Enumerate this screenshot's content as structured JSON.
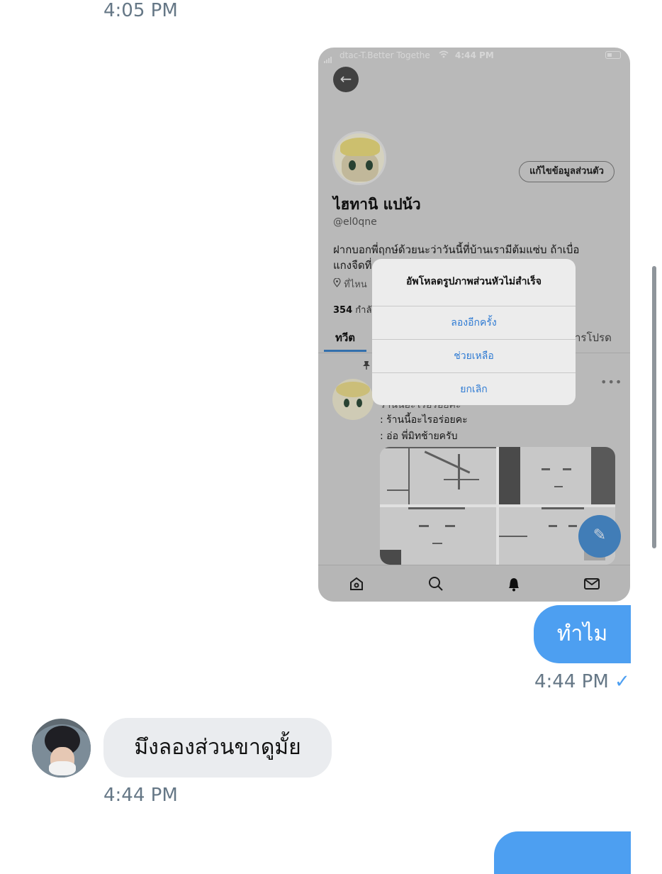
{
  "chat": {
    "timestamp_top": "4:05 PM",
    "sent_message": "ทำไม",
    "sent_time": "4:44 PM",
    "sent_check": "✓",
    "received_message": "มึงลองส่วนขาดูมั้ย",
    "received_time": "4:44 PM"
  },
  "screenshot": {
    "status_bar": {
      "carrier": "dtac-T.Better Togethe",
      "time": "4:44 PM"
    },
    "profile": {
      "edit_button": "แก้ไขข้อมูลส่วนตัว",
      "name": "ไฮทานิ แปน้ว",
      "handle": "@el0qne",
      "bio_line1": "ฝากบอกพี่ฤกษ์ด้วยนะว่าวันนี้ที่บ้านเรามีต้มแซ่บ ถ้าเบื่อ",
      "bio_line2": "แกงจืดที่",
      "location": "ที่ไหน",
      "count_value": "354",
      "count_label": "กำลั",
      "tab_first": "ทวีต",
      "tab_last": "ารโปรด"
    },
    "tweet": {
      "line1": "ร้านนี้อะไรอร่อยคะ",
      "line2": ": ร้านนี้อะไรอร่อยคะ",
      "line3": ": อ่อ พี่มิทช้ายครับ"
    },
    "alert": {
      "title": "อัพโหลดรูปภาพส่วนหัวไม่สำเร็จ",
      "buttons": [
        "ลองอีกครั้ง",
        "ช่วยเหลือ",
        "ยกเลิก"
      ]
    },
    "bottom_nav": [
      "home-icon",
      "search-icon",
      "bell-icon",
      "mail-icon"
    ]
  }
}
